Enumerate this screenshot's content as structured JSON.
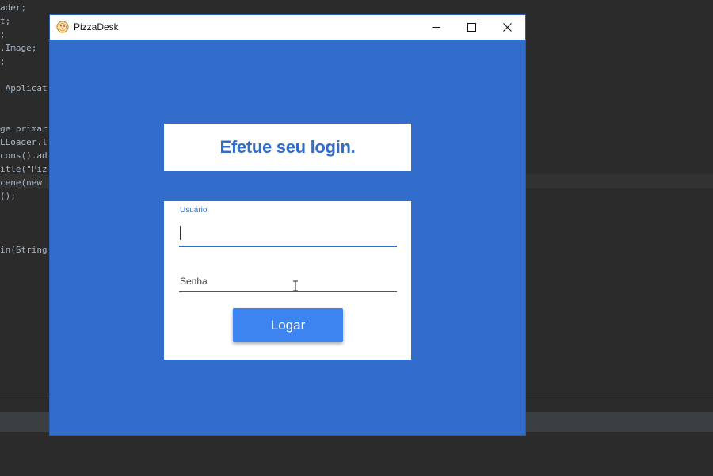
{
  "ide": {
    "code_lines": [
      "ader;",
      "t;",
      ";",
      ".Image;",
      ";",
      "",
      " Applicat",
      "",
      "",
      "ge primar",
      "LLoader.l",
      "cons().ad",
      "itle(\"Piz",
      "cene(new ",
      "();",
      "",
      "",
      "",
      "in(String"
    ]
  },
  "window": {
    "title": "PizzaDesk",
    "icon": "pizza-icon",
    "controls": [
      "minimize-icon",
      "maximize-icon",
      "close-icon"
    ]
  },
  "login": {
    "heading": "Efetue seu login.",
    "username_label": "Usuário",
    "username_value": "",
    "password_placeholder": "Senha",
    "submit_label": "Logar"
  },
  "colors": {
    "window_background": "#336dcb",
    "accent": "#2e6cd0",
    "button": "#3d84f0",
    "ide_background": "#2b2b2b"
  }
}
